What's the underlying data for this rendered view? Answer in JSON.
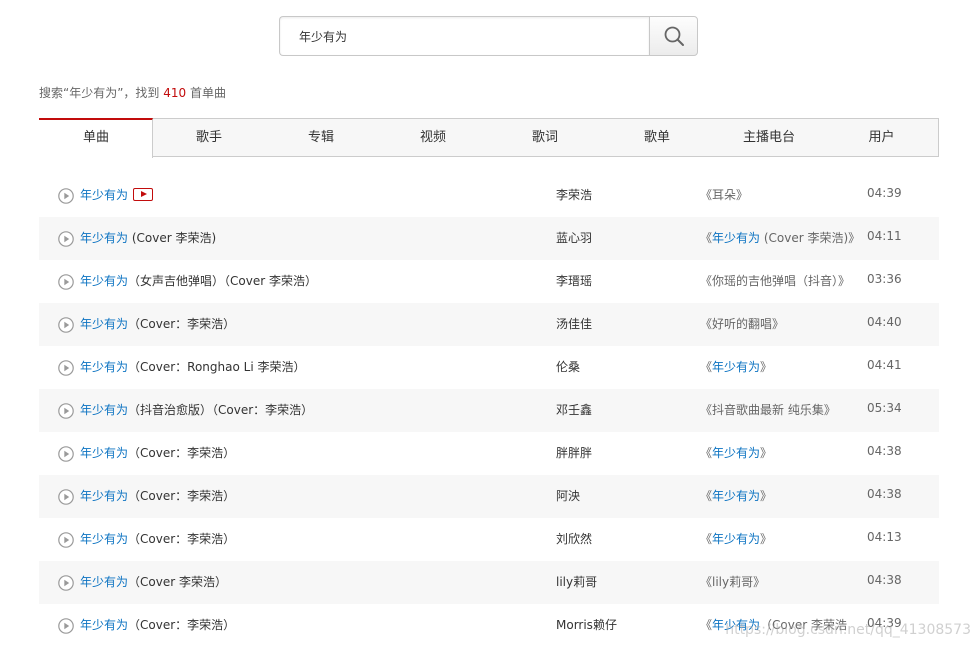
{
  "search": {
    "value": "年少有为",
    "button_icon": "search-icon"
  },
  "summary": {
    "prefix": "搜索“年少有为”，找到 ",
    "count": "410",
    "suffix": " 首单曲"
  },
  "tabs": [
    {
      "label": "单曲",
      "active": true
    },
    {
      "label": "歌手"
    },
    {
      "label": "专辑"
    },
    {
      "label": "视频"
    },
    {
      "label": "歌词"
    },
    {
      "label": "歌单"
    },
    {
      "label": "主播电台"
    },
    {
      "label": "用户"
    }
  ],
  "songs": [
    {
      "title": "年少有为",
      "extra": "",
      "mv": true,
      "artist": "李荣浩",
      "album_pre": "《耳朵》",
      "album_hl": "",
      "album_post": "",
      "duration": "04:39"
    },
    {
      "title": "年少有为",
      "extra": " (Cover 李荣浩)",
      "mv": false,
      "artist": "蓝心羽",
      "album_pre": "《",
      "album_hl": "年少有为",
      "album_post": " (Cover 李荣浩)》",
      "duration": "04:11"
    },
    {
      "title": "年少有为",
      "extra": "（女声吉他弹唱）（Cover 李荣浩）",
      "mv": false,
      "artist": "李瑨瑶",
      "album_pre": "《你瑶的吉他弹唱（抖音）》",
      "album_hl": "",
      "album_post": "",
      "duration": "03:36"
    },
    {
      "title": "年少有为",
      "extra": "（Cover：李荣浩）",
      "mv": false,
      "artist": "汤佳佳",
      "album_pre": "《好听的翻唱》",
      "album_hl": "",
      "album_post": "",
      "duration": "04:40"
    },
    {
      "title": "年少有为",
      "extra": "（Cover：Ronghao Li 李荣浩）",
      "mv": false,
      "artist": "伦桑",
      "album_pre": "《",
      "album_hl": "年少有为",
      "album_post": "》",
      "duration": "04:41"
    },
    {
      "title": "年少有为",
      "extra": "（抖音治愈版）（Cover：李荣浩）",
      "mv": false,
      "artist": "邓壬鑫",
      "album_pre": "《抖音歌曲最新 纯乐集》",
      "album_hl": "",
      "album_post": "",
      "duration": "05:34"
    },
    {
      "title": "年少有为",
      "extra": "（Cover：李荣浩）",
      "mv": false,
      "artist": "胖胖胖",
      "album_pre": "《",
      "album_hl": "年少有为",
      "album_post": "》",
      "duration": "04:38"
    },
    {
      "title": "年少有为",
      "extra": "（Cover：李荣浩）",
      "mv": false,
      "artist": "阿泱",
      "album_pre": "《",
      "album_hl": "年少有为",
      "album_post": "》",
      "duration": "04:38"
    },
    {
      "title": "年少有为",
      "extra": "（Cover：李荣浩）",
      "mv": false,
      "artist": "刘欣然",
      "album_pre": "《",
      "album_hl": "年少有为",
      "album_post": "》",
      "duration": "04:13"
    },
    {
      "title": "年少有为",
      "extra": "（Cover 李荣浩）",
      "mv": false,
      "artist": "lily莉哥",
      "album_pre": "《lily莉哥》",
      "album_hl": "",
      "album_post": "",
      "duration": "04:38"
    },
    {
      "title": "年少有为",
      "extra": "（Cover：李荣浩）",
      "mv": false,
      "artist": "Morris赖仔",
      "album_pre": "《",
      "album_hl": "年少有为",
      "album_post": "（Cover 李荣浩",
      "duration": "04:39"
    }
  ],
  "watermark": "https://blog.csdn.net/qq_41308573",
  "colors": {
    "accent": "#c20c0c",
    "link": "#0c73c2",
    "stripe": "#f7f7f7"
  }
}
